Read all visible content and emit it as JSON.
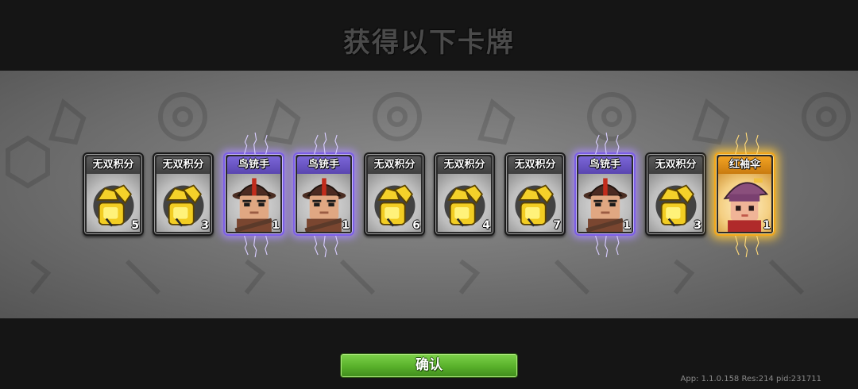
{
  "title": "获得以下卡牌",
  "cards": [
    {
      "name": "无双积分",
      "count": "5",
      "rarity": "common",
      "icon": "gold-glove-icon"
    },
    {
      "name": "无双积分",
      "count": "3",
      "rarity": "common",
      "icon": "gold-glove-icon"
    },
    {
      "name": "鸟铳手",
      "count": "1",
      "rarity": "epic",
      "icon": "musketeer-portrait"
    },
    {
      "name": "鸟铳手",
      "count": "1",
      "rarity": "epic",
      "icon": "musketeer-portrait"
    },
    {
      "name": "无双积分",
      "count": "6",
      "rarity": "common",
      "icon": "gold-glove-icon"
    },
    {
      "name": "无双积分",
      "count": "4",
      "rarity": "common",
      "icon": "gold-glove-icon"
    },
    {
      "name": "无双积分",
      "count": "7",
      "rarity": "common",
      "icon": "gold-glove-icon"
    },
    {
      "name": "鸟铳手",
      "count": "1",
      "rarity": "epic",
      "icon": "musketeer-portrait"
    },
    {
      "name": "无双积分",
      "count": "3",
      "rarity": "common",
      "icon": "gold-glove-icon"
    },
    {
      "name": "红袖伞",
      "count": "1",
      "rarity": "legendary",
      "icon": "red-sleeve-umbrella-portrait"
    }
  ],
  "confirm_label": "确认",
  "version_text": "App: 1.1.0.158 Res:214 pid:231711",
  "colors": {
    "epic_glow": "#aa8cff",
    "legendary_glow": "#ffc83c",
    "confirm_green": "#58b02a"
  }
}
